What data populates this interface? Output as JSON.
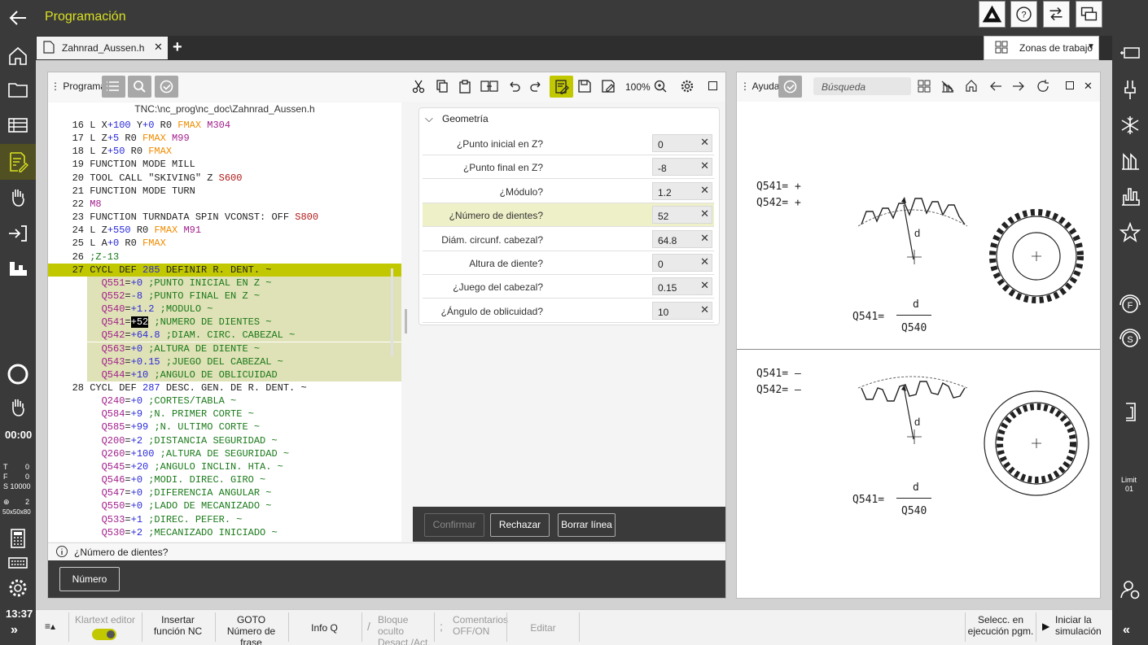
{
  "header": {
    "title": "Programación"
  },
  "tabs": [
    {
      "label": "Zahnrad_Aussen.h"
    }
  ],
  "zonas_label": "Zonas de trabajo",
  "programa": {
    "title": "Programa",
    "zoom": "100%",
    "path": "TNC:\\nc_prog\\nc_doc\\Zahnrad_Aussen.h",
    "question": "¿Número de dientes?",
    "numero_button": "Número"
  },
  "code": [
    {
      "n": "16",
      "t": "L X+100 Y+0 R0 FMAX M304"
    },
    {
      "n": "17",
      "t": "L Z+5 R0 FMAX M99"
    },
    {
      "n": "18",
      "t": "L Z+50 R0 FMAX"
    },
    {
      "n": "19",
      "t": "FUNCTION MODE MILL"
    },
    {
      "n": "20",
      "t": "TOOL CALL \"SKIVING\" Z S600"
    },
    {
      "n": "21",
      "t": "FUNCTION MODE TURN"
    },
    {
      "n": "22",
      "t": "M8"
    },
    {
      "n": "23",
      "t": "FUNCTION TURNDATA SPIN VCONST: OFF S800"
    },
    {
      "n": "24",
      "t": "L Z+550 R0 FMAX M91"
    },
    {
      "n": "25",
      "t": "L A+0 R0 FMAX"
    },
    {
      "n": "26",
      "t": ";Z-13"
    },
    {
      "n": "27",
      "t": "CYCL DEF 285 DEFINIR R. DENT. ~"
    },
    {
      "n": "",
      "t": "  Q551=+0 ;PUNTO INICIAL EN Z ~"
    },
    {
      "n": "",
      "t": "  Q552=-8 ;PUNTO FINAL EN Z ~"
    },
    {
      "n": "",
      "t": "  Q540=+1.2 ;MODULO ~"
    },
    {
      "n": "",
      "t": "  Q541=+52 ;NUMERO DE DIENTES ~"
    },
    {
      "n": "",
      "t": "  Q542=+64.8 ;DIAM. CIRC. CABEZAL ~"
    },
    {
      "n": "",
      "t": "  Q563=+0 ;ALTURA DE DIENTE ~"
    },
    {
      "n": "",
      "t": "  Q543=+0.15 ;JUEGO DEL CABEZAL ~"
    },
    {
      "n": "",
      "t": "  Q544=+10 ;ANGULO DE OBLICUIDAD"
    },
    {
      "n": "28",
      "t": "CYCL DEF 287 DESC. GEN. DE R. DENT. ~"
    },
    {
      "n": "",
      "t": "  Q240=+0 ;CORTES/TABLA ~"
    },
    {
      "n": "",
      "t": "  Q584=+9 ;N. PRIMER CORTE ~"
    },
    {
      "n": "",
      "t": "  Q585=+99 ;N. ULTIMO CORTE ~"
    },
    {
      "n": "",
      "t": "  Q200=+2 ;DISTANCIA SEGURIDAD ~"
    },
    {
      "n": "",
      "t": "  Q260=+100 ;ALTURA DE SEGURIDAD ~"
    },
    {
      "n": "",
      "t": "  Q545=+20 ;ANGULO INCLIN. HTA. ~"
    },
    {
      "n": "",
      "t": "  Q546=+0 ;MODI. DIREC. GIRO ~"
    },
    {
      "n": "",
      "t": "  Q547=+0 ;DIFERENCIA ANGULAR ~"
    },
    {
      "n": "",
      "t": "  Q550=+0 ;LADO DE MECANIZADO ~"
    },
    {
      "n": "",
      "t": "  Q533=+1 ;DIREC. PEFER. ~"
    },
    {
      "n": "",
      "t": "  Q530=+2 ;MECANIZADO INICIADO ~"
    }
  ],
  "form": {
    "section": "Geometría",
    "rows": [
      {
        "label": "¿Punto inicial en Z?",
        "value": "0"
      },
      {
        "label": "¿Punto final en Z?",
        "value": "-8"
      },
      {
        "label": "¿Módulo?",
        "value": "1.2"
      },
      {
        "label": "¿Número de dientes?",
        "value": "52"
      },
      {
        "label": "Diám. circunf. cabezal?",
        "value": "64.8"
      },
      {
        "label": "Altura de diente?",
        "value": "0"
      },
      {
        "label": "¿Juego del cabezal?",
        "value": "0.15"
      },
      {
        "label": "¿Ángulo de oblicuidad?",
        "value": "10"
      }
    ],
    "confirm": "Confirmar",
    "reject": "Rechazar",
    "delete_line": "Borrar línea"
  },
  "ayuda": {
    "title": "Ayuda",
    "search_placeholder": "Búsqueda",
    "top": {
      "l1": "Q541= +",
      "l2": "Q542= +",
      "d": "d",
      "fl": "Q541=",
      "num": "d",
      "den": "Q540"
    },
    "bottom": {
      "l1": "Q541= –",
      "l2": "Q542= –",
      "d": "d",
      "fl": "Q541=",
      "num": "d",
      "den": "Q540"
    }
  },
  "status": {
    "time_run": "00:00",
    "t": "T",
    "t_val": "0",
    "f": "F",
    "f_val": "0",
    "s": "S 10000",
    "tool_icon_val": "2",
    "size": "50x50x80",
    "clock": "13:37",
    "limit": "Limit",
    "limit_val": "01"
  },
  "softkeys": [
    {
      "label": "Klartext editor"
    },
    {
      "label": "Insertar\nfunción NC"
    },
    {
      "label": "GOTO\nNúmero de frase"
    },
    {
      "label": "Info Q"
    },
    {
      "label": "Bloque oculto\nDesact./Act."
    },
    {
      "label": "Comentarios\nOFF/ON"
    },
    {
      "label": "Editar"
    },
    {
      "label": "Selecc. en\nejecución pgm."
    },
    {
      "label": "Iniciar la\nsimulación"
    }
  ],
  "colors": {
    "accent": "#d9e021",
    "highlight": "#c2c800",
    "dark": "#3a3a3a"
  }
}
